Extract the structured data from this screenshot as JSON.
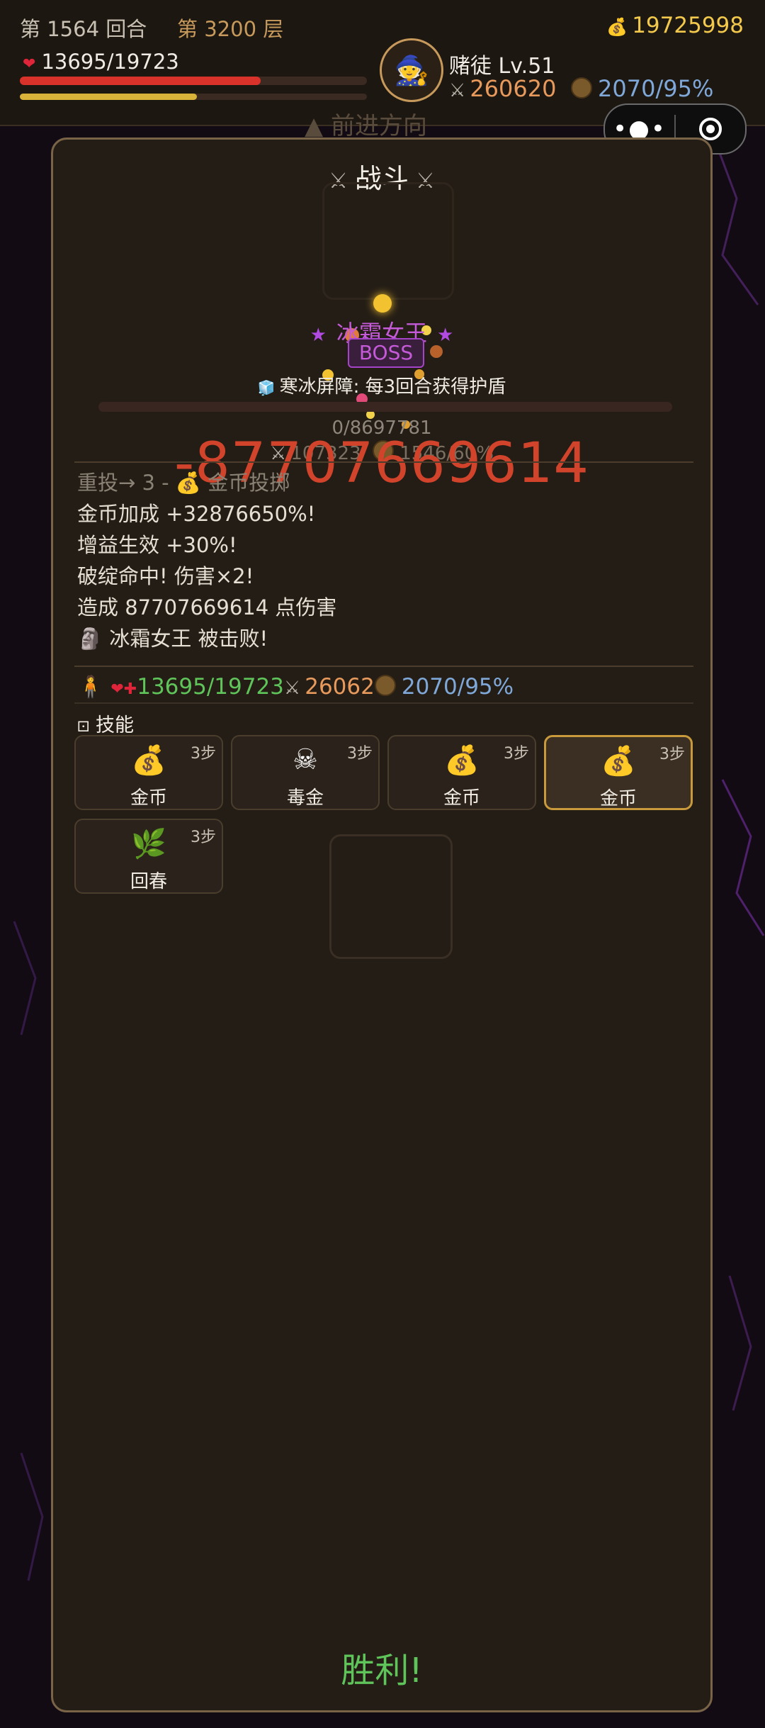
{
  "hud": {
    "round": "第 1564 回合",
    "floor": "第 3200 层",
    "gold": "19725998",
    "hp_text": "13695/19723",
    "hp_fraction": 0.694,
    "exp_fraction": 0.51,
    "player_name": "赌徒 Lv.51",
    "attack": "260620",
    "defense": "2070/95%",
    "colors": {
      "hp": "#d9322a",
      "exp": "#d9b23a",
      "gold": "#f2c94c"
    }
  },
  "capsule": {
    "more_icon": "more-dots-icon",
    "close_icon": "target-icon"
  },
  "ghost": {
    "forward": "▲ 前进方向"
  },
  "battle": {
    "title": "战斗",
    "boss_name": "冰霜女王",
    "boss_tag": "BOSS",
    "shield_text": "寒冰屏障: 每3回合获得护盾",
    "enemy_hp": "0/8697781",
    "enemy_attack": "107323",
    "enemy_defense": "1546/60%",
    "enemy_hp_fraction": 0,
    "damage_float": "-87707669614"
  },
  "log": [
    "重投→ 3 - 💰 金币投掷",
    "金币加成 +32876650%!",
    "增益生效 +30%!",
    "破绽命中! 伤害×2!",
    "造成 87707669614 点伤害",
    "冰霜女王 被击败!"
  ],
  "player_stats": {
    "hp": "13695/19723",
    "atk": "26062",
    "def": "2070/95%"
  },
  "skills": {
    "title": "技能",
    "items": [
      {
        "label": "金币",
        "steps": "3步",
        "icon": "💰"
      },
      {
        "label": "毒金",
        "steps": "3步",
        "icon": "☠"
      },
      {
        "label": "金币",
        "steps": "3步",
        "icon": "💰"
      },
      {
        "label": "金币",
        "steps": "3步",
        "icon": "💰"
      },
      {
        "label": "回春",
        "steps": "3步",
        "icon": "🌿"
      }
    ]
  },
  "result": "胜利!"
}
